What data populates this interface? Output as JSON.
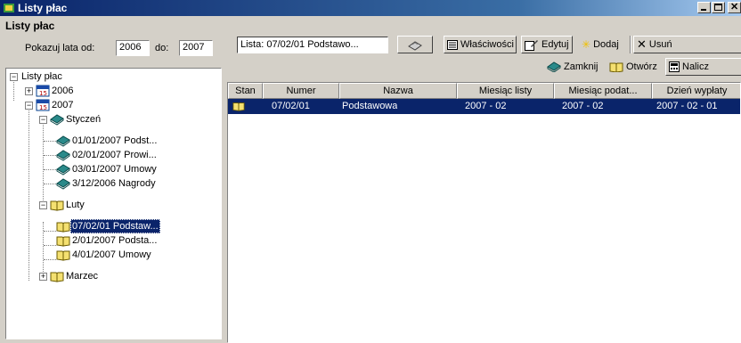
{
  "window": {
    "title": "Listy płac"
  },
  "left_panel": {
    "header": "Listy płac",
    "years_from_label": "Pokazuj lata od:",
    "years_from": "2006",
    "years_to_label": "do:",
    "years_to": "2007"
  },
  "tree": {
    "root": "Listy płac",
    "y2006": "2006",
    "y2007": "2007",
    "styczen": "Styczeń",
    "styczen_items": [
      "01/01/2007  Podst...",
      "02/01/2007  Prowi...",
      "03/01/2007  Umowy",
      "3/12/2006  Nagrody"
    ],
    "luty": "Luty",
    "luty_items": [
      "07/02/01  Podstaw...",
      "2/01/2007  Podsta...",
      "4/01/2007  Umowy"
    ],
    "marzec": "Marzec"
  },
  "toolbar": {
    "lista_label": "Lista: 07/02/01  Podstawo...",
    "wlasciwosci": "Właściwości",
    "edytuj": "Edytuj",
    "dodaj": "Dodaj",
    "usun": "Usuń",
    "zamknij": "Zamknij",
    "otworz": "Otwórz",
    "nalicz": "Nalicz"
  },
  "table": {
    "columns": [
      "Stan",
      "Numer",
      "Nazwa",
      "Miesiąc listy",
      "Miesiąc podat...",
      "Dzień wypłaty"
    ],
    "rows": [
      {
        "numer": "07/02/01",
        "nazwa": "Podstawowa",
        "miesiac_listy": "2007 - 02",
        "miesiac_podat": "2007 - 02",
        "dzien_wyplaty": "2007 - 02 - 01"
      }
    ]
  },
  "colors": {
    "selection": "#0a246a",
    "face": "#d4d0c8",
    "title_start": "#0a246a",
    "title_end": "#a6caf0"
  }
}
